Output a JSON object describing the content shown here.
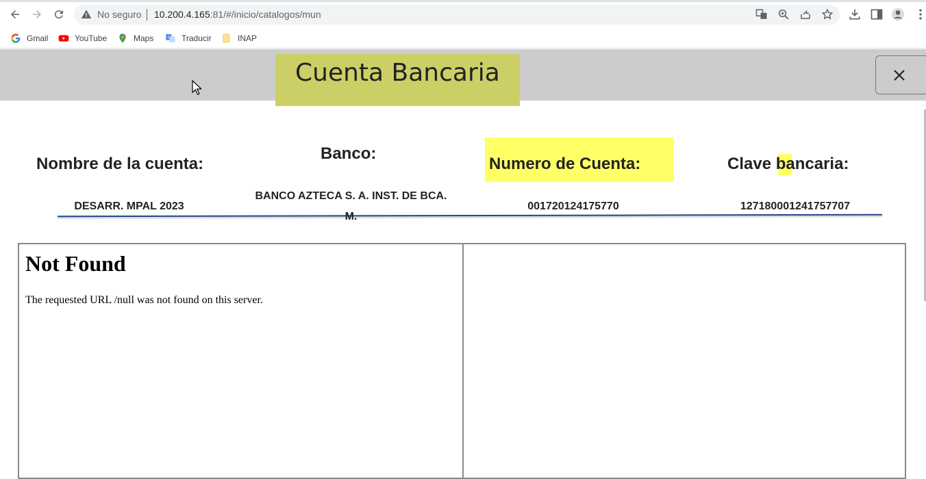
{
  "browser": {
    "omnibox": {
      "security_label": "No seguro",
      "url_host": "10.200.4.165",
      "url_rest": ":81/#/inicio/catalogos/mun"
    },
    "bookmarks": [
      {
        "label": "Gmail",
        "icon": "gmail-icon"
      },
      {
        "label": "YouTube",
        "icon": "youtube-icon"
      },
      {
        "label": "Maps",
        "icon": "maps-icon"
      },
      {
        "label": "Traducir",
        "icon": "translate-icon"
      },
      {
        "label": "INAP",
        "icon": "folder-icon"
      }
    ]
  },
  "modal": {
    "title": "Cuenta Bancaria",
    "close_icon": "close-icon",
    "columns": {
      "account_name_label": "Nombre de la cuenta:",
      "bank_label": "Banco:",
      "account_number_label": "Numero de Cuenta:",
      "clabe_label_pre": "Clave ",
      "clabe_label_hl": "b",
      "clabe_label_post": "ancaria:"
    },
    "values": {
      "account_name": "DESARR. MPAL 2023",
      "bank_line1": "BANCO AZTECA S. A. INST. DE BCA.",
      "bank_line2": "M.",
      "account_number": "001720124175770",
      "clabe": "127180001241757707"
    },
    "colors": {
      "title_highlight": "#cccf66",
      "label_highlight": "#ffff66",
      "underline": "#1a4a8a"
    }
  },
  "frame_left": {
    "heading": "Not Found",
    "message": "The requested URL /null was not found on this server."
  }
}
